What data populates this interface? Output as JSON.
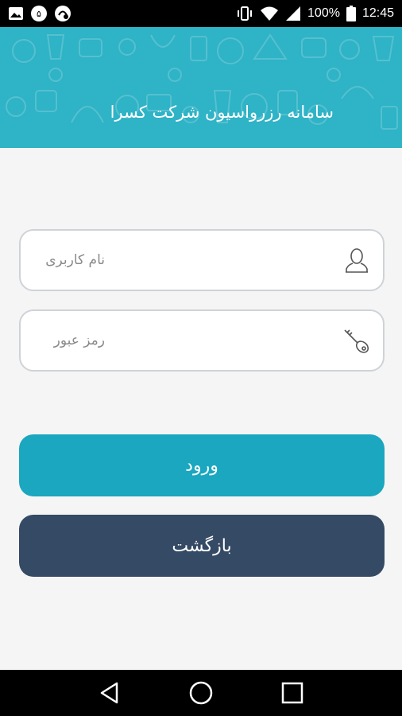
{
  "status_bar": {
    "battery": "100%",
    "time": "12:45",
    "icons": [
      "image-icon",
      "vpn-icon",
      "app-icon",
      "vibrate-icon",
      "wifi-icon",
      "signal-icon",
      "battery-icon"
    ]
  },
  "header": {
    "title": "سامانه رزرواسیون شرکت کسرا",
    "background_color": "#2fb3c6"
  },
  "form": {
    "username_placeholder": "نام کاربری",
    "username_value": "",
    "username_icon": "user-icon",
    "password_placeholder": "رمز عبور",
    "password_value": "",
    "password_icon": "key-icon"
  },
  "buttons": {
    "login_label": "ورود",
    "login_color": "#1aa7bf",
    "back_label": "بازگشت",
    "back_color": "#354a64"
  },
  "nav_bar": {
    "icons": [
      "back-triangle-icon",
      "home-circle-icon",
      "recents-square-icon"
    ]
  }
}
